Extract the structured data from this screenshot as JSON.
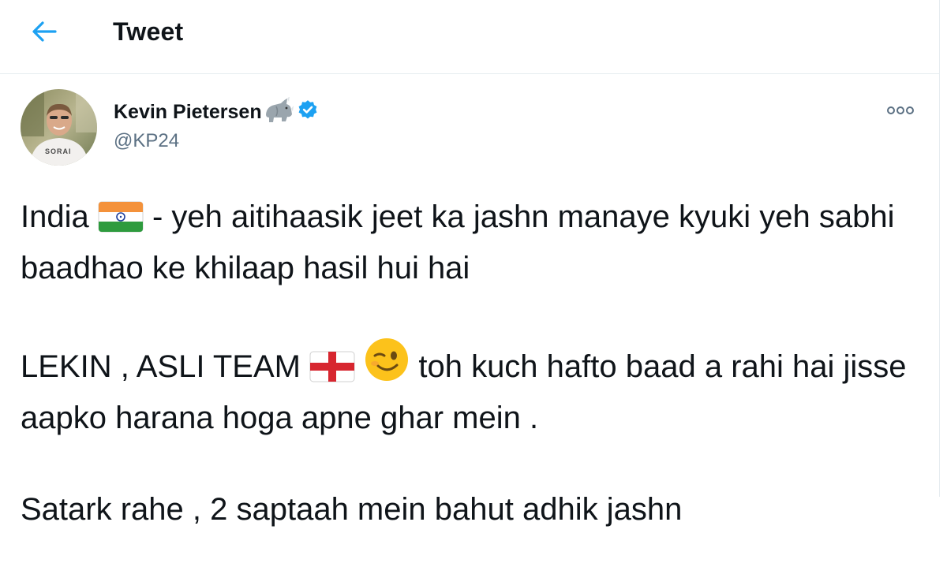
{
  "header": {
    "title": "Tweet",
    "back_icon": "arrow-left-icon",
    "accent": "#1da1f2"
  },
  "tweet": {
    "author": {
      "display_name": "Kevin Pietersen",
      "name_emoji": "rhino-emoji",
      "verified": true,
      "verified_icon": "verified-badge-icon",
      "handle": "@KP24",
      "avatar_shirt_text": "SORAI"
    },
    "more_icon": "more-horizontal-icon",
    "paragraphs": [
      {
        "before": "India",
        "emoji": "india-flag-emoji",
        "after": "- yeh aitihaasik jeet ka jashn manaye kyuki yeh sabhi baadhao ke khilaap hasil hui hai"
      },
      {
        "before": "LEKIN , ASLI TEAM",
        "emoji": "england-flag-emoji",
        "emoji2": "winking-face-emoji",
        "after": "toh kuch hafto baad a rahi hai jisse aapko harana hoga apne ghar mein ."
      },
      {
        "text": "Satark rahe , 2 saptaah mein bahut adhik jashn"
      }
    ]
  },
  "colors": {
    "text": "#0f1419",
    "secondary_text": "#5b7083",
    "divider": "#e6ecf0",
    "verified_blue": "#1da1f2"
  }
}
